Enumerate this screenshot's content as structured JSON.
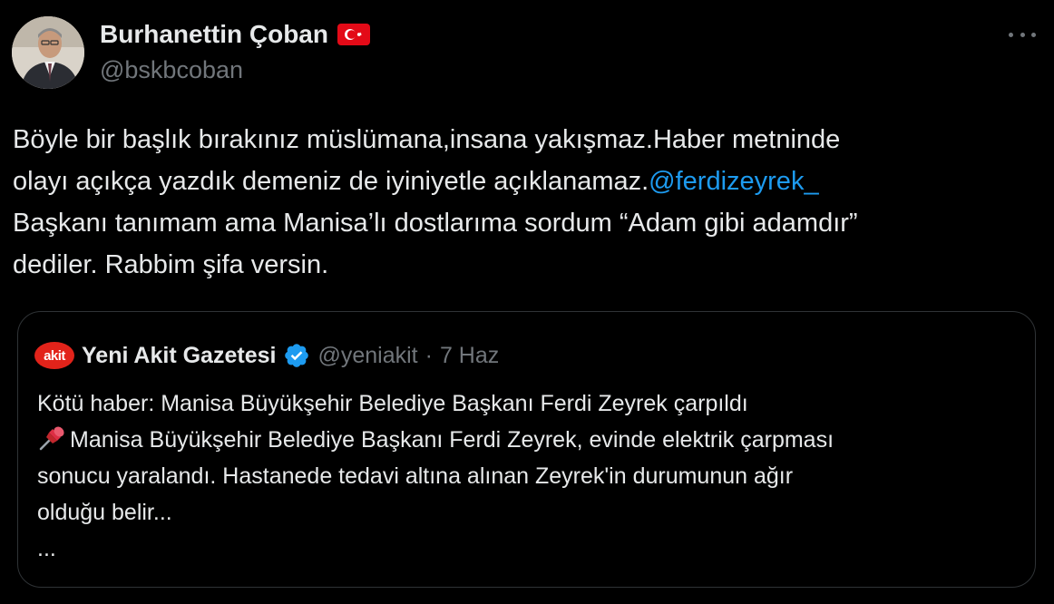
{
  "author": {
    "display_name": "Burhanettin Çoban",
    "handle": "@bskbcoban",
    "flag_icon": "turkey-flag-icon",
    "more_icon": "more-options-icon"
  },
  "tweet": {
    "lines": [
      {
        "text": "Böyle bir başlık bırakınız müslümana,insana yakışmaz.Haber metninde"
      },
      {
        "text": "olayı açıkça yazdık demeniz de iyiniyetle açıklanamaz.",
        "mention": "@ferdizeyrek_"
      },
      {
        "text": "Başkanı tanımam ama Manisa’lı dostlarıma sordum “Adam gibi adamdır”"
      },
      {
        "text": "dediler. Rabbim şifa versin."
      }
    ]
  },
  "quoted": {
    "logo_text": "akit",
    "name": "Yeni Akit Gazetesi",
    "verified_icon": "verified-badge-icon",
    "handle": "@yeniakit",
    "separator": "·",
    "time": "7 Haz",
    "lines": [
      "Kötü haber: Manisa Büyükşehir Belediye Başkanı Ferdi Zeyrek çarpıldı",
      "Manisa Büyükşehir Belediye Başkanı Ferdi Zeyrek, evinde elektrik çarpması",
      "sonucu yaralandı. Hastanede tedavi altına alınan Zeyrek'in durumunun ağır",
      "olduğu belir...",
      "..."
    ],
    "pin_icon": "pushpin-icon"
  },
  "colors": {
    "background": "#000000",
    "text": "#e7e9ea",
    "muted": "#71767b",
    "link": "#1d9bf0",
    "border": "#2f3336",
    "akit_red": "#e2231a"
  }
}
